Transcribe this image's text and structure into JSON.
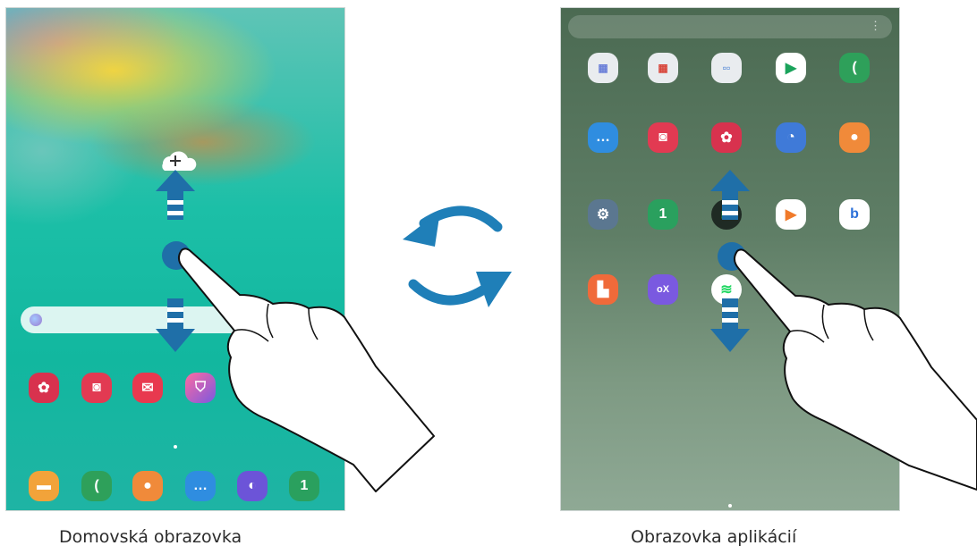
{
  "captions": {
    "home": "Domovská obrazovka",
    "apps": "Obrazovka aplikácií"
  },
  "colors": {
    "accent_blue": "#1f6fa8",
    "swap_arrow": "#1f7fb8",
    "home_bg": "#14b9a2",
    "apps_bg": "#5f7e66"
  },
  "home_screen": {
    "icons": {
      "add_to_home": "cloud-plus-icon",
      "swipe_up": "arrow-up-icon",
      "swipe_down": "arrow-down-icon",
      "touch_point": "touch-point-icon",
      "hand": "pointing-hand-icon"
    },
    "row_apps": [
      "gallery-icon",
      "camera-icon",
      "email-icon",
      "galaxy-apps-icon"
    ],
    "dock_apps": [
      "folder-icon",
      "phone-icon",
      "contacts-icon",
      "messages-icon",
      "internet-icon",
      "calendar-icon"
    ]
  },
  "apps_screen": {
    "rows": [
      [
        "samsung-folder-icon",
        "google-folder-icon",
        "microsoft-folder-icon",
        "play-store-icon",
        "phone-icon"
      ],
      [
        "messages-icon",
        "camera-icon",
        "gallery-icon",
        "clock-icon",
        "contacts-icon"
      ],
      [
        "settings-icon",
        "calendar-icon",
        "spotify-icon",
        "play-music-icon",
        "bixby-icon"
      ],
      [
        "samsung-notes-icon",
        "game-launcher-icon",
        "spotify-icon"
      ]
    ]
  },
  "swap_icon": "swap-cycle-icon"
}
